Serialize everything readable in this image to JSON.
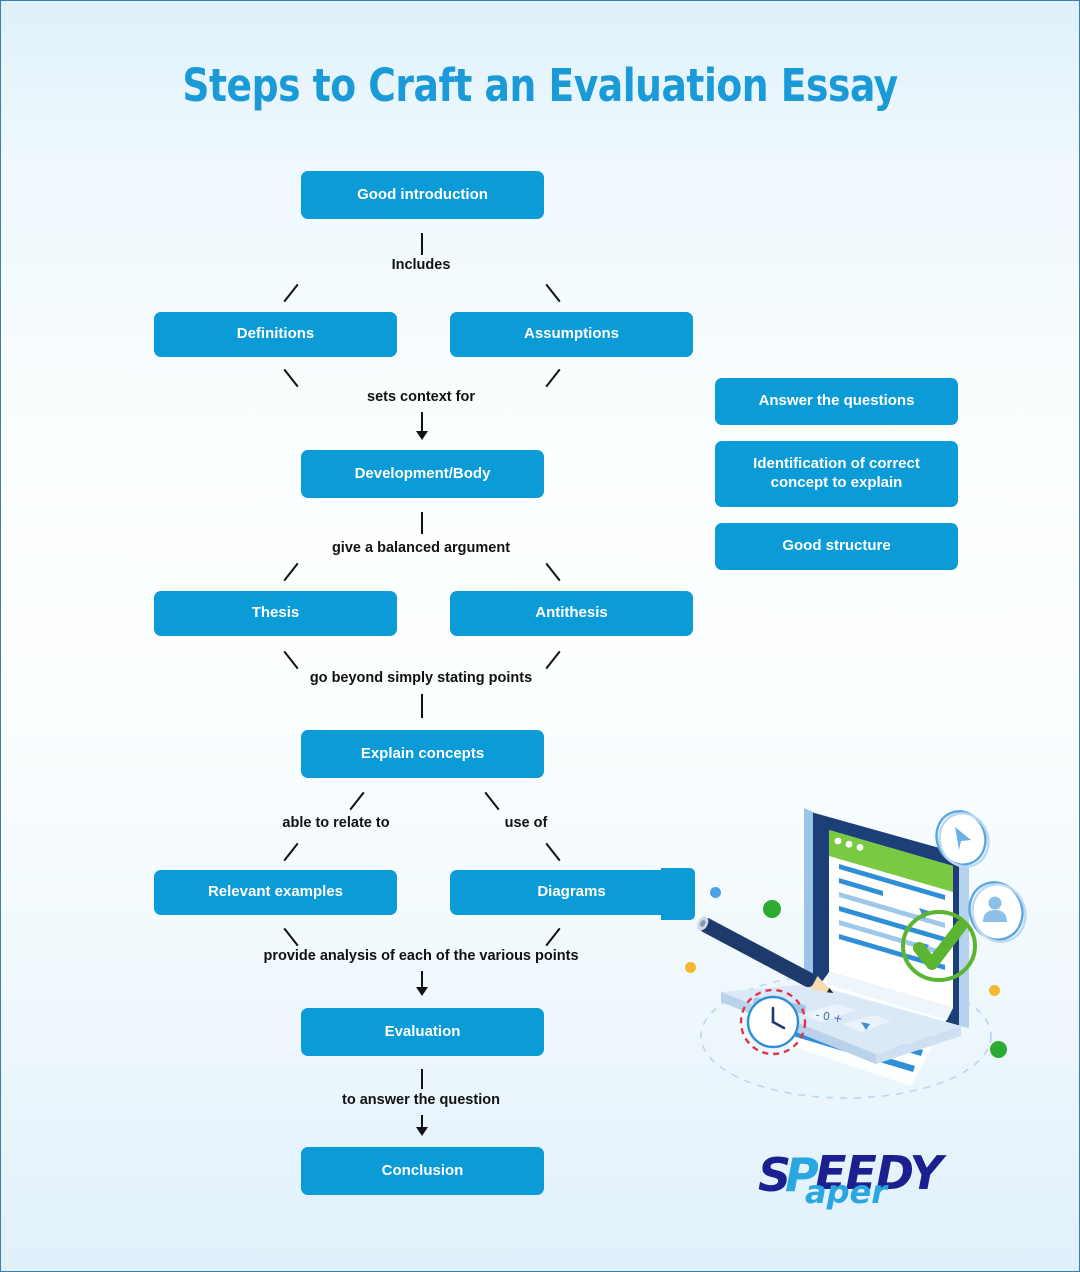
{
  "page": {
    "title": "Steps to Craft an Evaluation Essay",
    "accent_blue": "#0b9bd7",
    "title_blue": "#1a9bd7",
    "connector_color": "#111111",
    "background": "#edf7fc"
  },
  "flow": {
    "nodes": [
      {
        "id": "good-introduction",
        "label": "Good introduction"
      },
      {
        "id": "definitions",
        "label": "Definitions"
      },
      {
        "id": "assumptions",
        "label": "Assumptions"
      },
      {
        "id": "development-body",
        "label": "Development/Body"
      },
      {
        "id": "thesis",
        "label": "Thesis"
      },
      {
        "id": "antithesis",
        "label": "Antithesis"
      },
      {
        "id": "explain-concepts",
        "label": "Explain concepts"
      },
      {
        "id": "relevant-examples",
        "label": "Relevant examples"
      },
      {
        "id": "diagrams",
        "label": "Diagrams"
      },
      {
        "id": "evaluation",
        "label": "Evaluation"
      },
      {
        "id": "conclusion",
        "label": "Conclusion"
      }
    ],
    "connector_labels": [
      {
        "id": "includes",
        "text": "Includes"
      },
      {
        "id": "sets-context-for",
        "text": "sets context for"
      },
      {
        "id": "balanced-argument",
        "text": "give a balanced argument"
      },
      {
        "id": "go-beyond",
        "text": "go beyond simply stating points"
      },
      {
        "id": "able-to-relate-to",
        "text": "able to relate to"
      },
      {
        "id": "use-of",
        "text": "use of"
      },
      {
        "id": "provide-analysis",
        "text": "provide analysis of each of the various points"
      },
      {
        "id": "to-answer-question",
        "text": "to answer the question"
      }
    ]
  },
  "side_panel": {
    "items": [
      {
        "id": "answer-the-questions",
        "label": "Answer the questions"
      },
      {
        "id": "identification",
        "label": "Identification of correct concept to explain"
      },
      {
        "id": "good-structure",
        "label": "Good structure"
      }
    ]
  },
  "logo": {
    "part_s": "S",
    "part_p": "P",
    "part_eedy": "EEDY",
    "part_aper": "aper"
  },
  "illustration": {
    "name": "isometric-laptop-document-pencil-checkmark",
    "colors": {
      "laptop_dark": "#1c3f78",
      "laptop_body": "#cfe2f5",
      "screen_bar": "#7ac943",
      "check_green": "#5cb531",
      "pencil_navy": "#1d3a6b",
      "dot_green": "#2bac30",
      "dot_blue": "#4aa3e8",
      "dot_yellow": "#f5b82e",
      "clock_red": "#e0344b"
    }
  }
}
